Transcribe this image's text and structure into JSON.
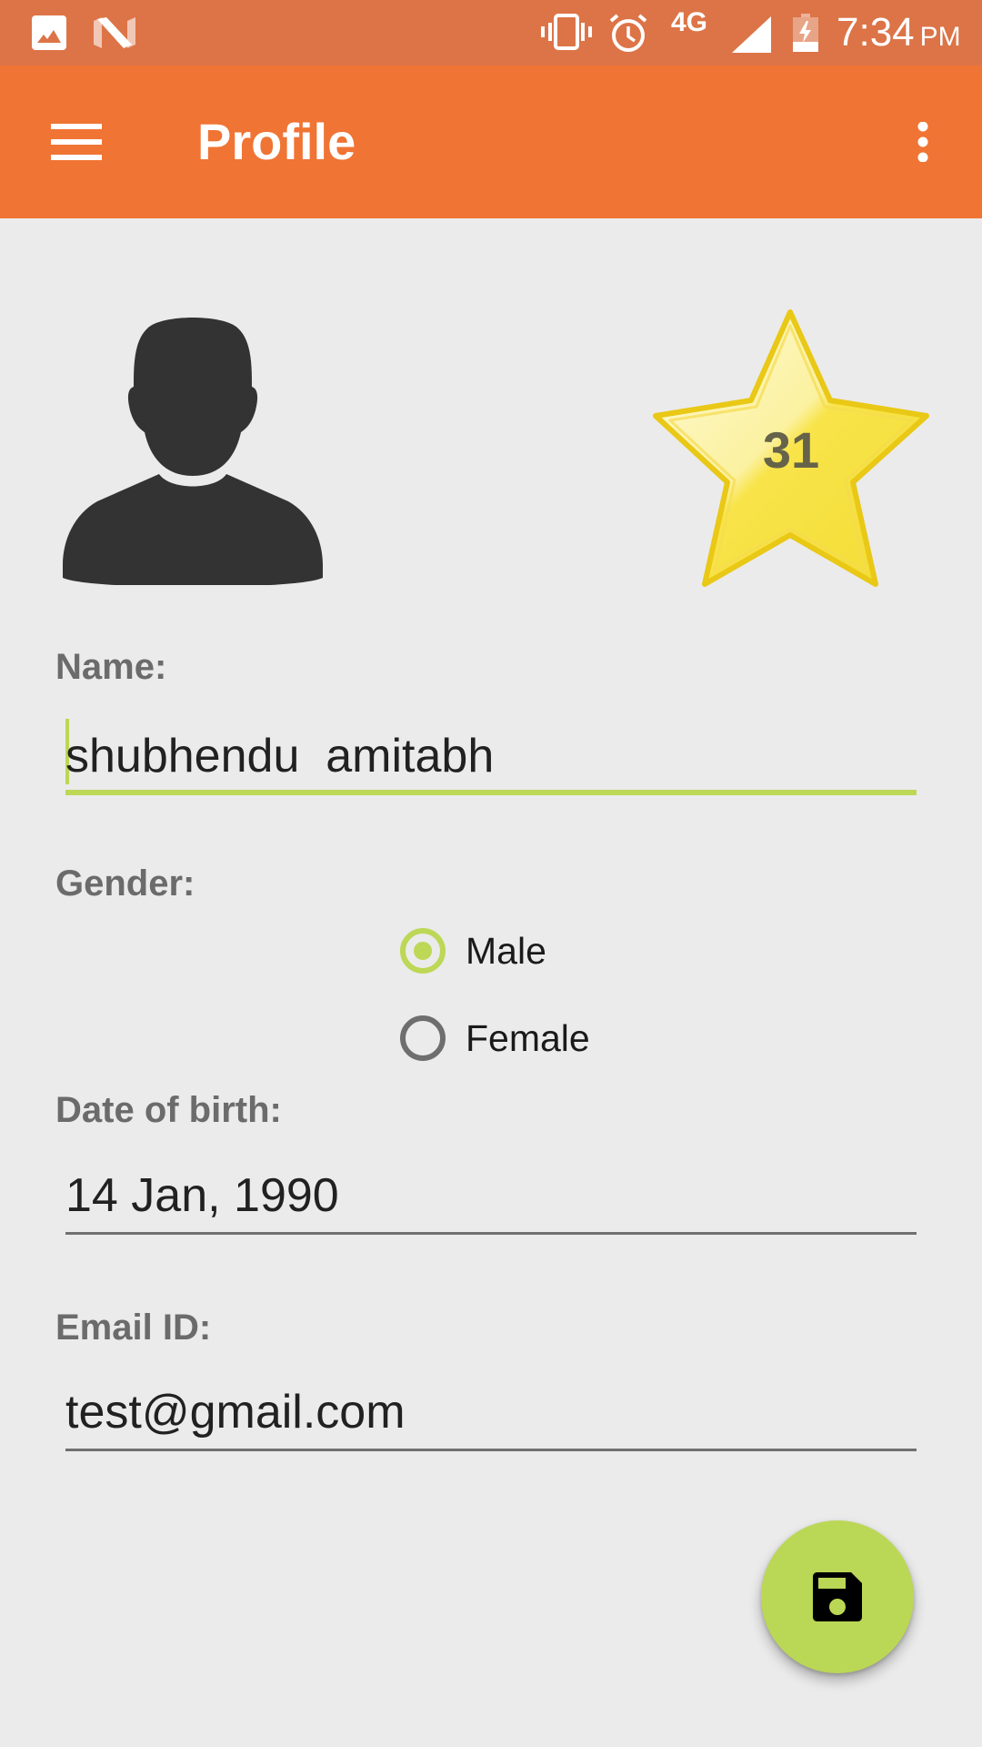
{
  "status_bar": {
    "notification_icons": [
      "image-icon",
      "android-n-icon"
    ],
    "system_icons": [
      "vibrate-icon",
      "alarm-icon",
      "signal-icon",
      "battery-charging-icon"
    ],
    "network": "4G",
    "time": "7:34",
    "ampm": "PM"
  },
  "app_bar": {
    "title": "Profile",
    "menu_icon": "hamburger-menu-icon",
    "overflow_icon": "more-vertical-icon"
  },
  "profile": {
    "avatar_icon": "person-silhouette-icon",
    "points_badge": "31",
    "points_icon": "star-icon"
  },
  "form": {
    "name_label": "Name:",
    "name_value": "shubhendu  amitabh",
    "gender_label": "Gender:",
    "gender_options": [
      {
        "label": "Male",
        "selected": true
      },
      {
        "label": "Female",
        "selected": false
      }
    ],
    "dob_label": "Date of birth:",
    "dob_value": "14 Jan, 1990",
    "email_label": "Email ID:",
    "email_value": "test@gmail.com"
  },
  "fab": {
    "icon": "save-icon",
    "action": "Save"
  },
  "colors": {
    "status_bar": "#DC7447",
    "app_bar": "#F07434",
    "background": "#EBEBEB",
    "accent": "#BBD756",
    "label_text": "#6B6B6B",
    "input_text": "#212121"
  }
}
